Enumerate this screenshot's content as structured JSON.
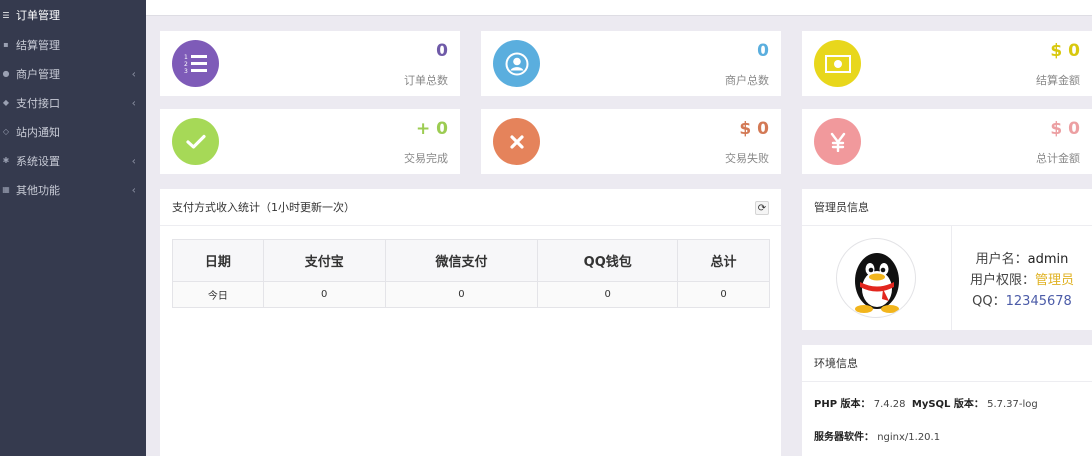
{
  "sidebar": {
    "items": [
      {
        "label": "订单管理",
        "icon": "list-icon",
        "active": true,
        "has_caret": false
      },
      {
        "label": "结算管理",
        "icon": "wallet-icon",
        "active": false,
        "has_caret": false
      },
      {
        "label": "商户管理",
        "icon": "user-icon",
        "active": false,
        "has_caret": true
      },
      {
        "label": "支付接口",
        "icon": "plug-icon",
        "active": false,
        "has_caret": true
      },
      {
        "label": "站内通知",
        "icon": "bell-icon",
        "active": false,
        "has_caret": false
      },
      {
        "label": "系统设置",
        "icon": "gear-icon",
        "active": false,
        "has_caret": true
      },
      {
        "label": "其他功能",
        "icon": "grid-icon",
        "active": false,
        "has_caret": true
      }
    ]
  },
  "stats": [
    {
      "value": "0",
      "label": "订单总数",
      "icon": "ordered-list-icon",
      "circle_color": "#7e5bb8",
      "value_color": "#6f5aa8"
    },
    {
      "value": "0",
      "label": "商户总数",
      "icon": "user-circle-icon",
      "circle_color": "#5aaede",
      "value_color": "#5aaede"
    },
    {
      "value": "$ 0",
      "label": "结算金额",
      "icon": "money-icon",
      "circle_color": "#e8d71c",
      "value_color": "#d8c80e"
    },
    {
      "value": "+ 0",
      "label": "交易完成",
      "icon": "check-icon",
      "circle_color": "#a6d957",
      "value_color": "#9ccc52"
    },
    {
      "value": "$ 0",
      "label": "交易失败",
      "icon": "x-icon",
      "circle_color": "#e5835b",
      "value_color": "#d37955"
    },
    {
      "value": "$ 0",
      "label": "总计金额",
      "icon": "yen-icon",
      "circle_color": "#f1999c",
      "value_color": "#ec9fa2"
    }
  ],
  "income": {
    "title": "支付方式收入统计（1小时更新一次）",
    "columns": [
      "日期",
      "支付宝",
      "微信支付",
      "QQ钱包",
      "总计"
    ],
    "rows": [
      [
        "今日",
        "0",
        "0",
        "0",
        "0"
      ]
    ]
  },
  "admin": {
    "title": "管理员信息",
    "username_label": "用户名：",
    "username": "admin",
    "role_label": "用户权限：",
    "role": "管理员",
    "qq_label": "QQ：",
    "qq": "12345678"
  },
  "env": {
    "title": "环境信息",
    "php_label": "PHP 版本：",
    "php_value": "7.4.28",
    "mysql_label": "MySQL 版本：",
    "mysql_value": "5.7.37-log",
    "server_label": "服务器软件：",
    "server_value": "nginx/1.20.1"
  }
}
